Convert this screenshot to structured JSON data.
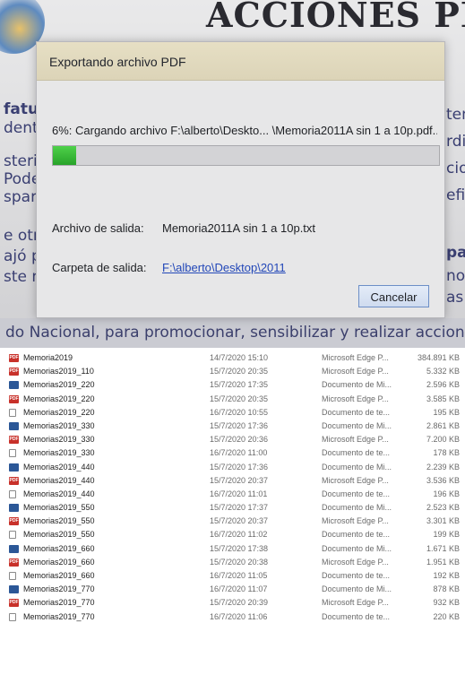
{
  "background_doc": {
    "title": "ACCIONES PRINCI",
    "left_fragments": [
      "fatur",
      "dent",
      "steric",
      "Pode",
      "spare",
      "e otr",
      "ajó p",
      "ste m"
    ],
    "right_fragments": [
      "ten",
      "rdi",
      "cion",
      "efic",
      "par",
      "nor",
      "as d"
    ],
    "bottom_line": "do Nacional, para promocionar, sensibilizar y realizar acciones ligada"
  },
  "dialog": {
    "title": "Exportando archivo PDF",
    "progress_text": "6%: Cargando archivo F:\\alberto\\Deskto... \\Memoria2011A sin 1 a 10p.pdf...",
    "progress_fraction": 0.06,
    "output_file_label": "Archivo de salida:",
    "output_file_value": "Memoria2011A sin 1 a 10p.txt",
    "output_folder_label": "Carpeta de salida:",
    "output_folder_value": "F:\\alberto\\Desktop\\2011",
    "cancel_label": "Cancelar"
  },
  "files": [
    {
      "icon": "pdf",
      "name": "Memoria2019",
      "date": "14/7/2020 15:10",
      "type": "Microsoft Edge P...",
      "size": "384.891 KB"
    },
    {
      "icon": "pdf",
      "name": "Memorias2019_110",
      "date": "15/7/2020 20:35",
      "type": "Microsoft Edge P...",
      "size": "5.332 KB"
    },
    {
      "icon": "doc",
      "name": "Memorias2019_220",
      "date": "15/7/2020 17:35",
      "type": "Documento de Mi...",
      "size": "2.596 KB"
    },
    {
      "icon": "pdf",
      "name": "Memorias2019_220",
      "date": "15/7/2020 20:35",
      "type": "Microsoft Edge P...",
      "size": "3.585 KB"
    },
    {
      "icon": "txt",
      "name": "Memorias2019_220",
      "date": "16/7/2020 10:55",
      "type": "Documento de te...",
      "size": "195 KB"
    },
    {
      "icon": "doc",
      "name": "Memorias2019_330",
      "date": "15/7/2020 17:36",
      "type": "Documento de Mi...",
      "size": "2.861 KB"
    },
    {
      "icon": "pdf",
      "name": "Memorias2019_330",
      "date": "15/7/2020 20:36",
      "type": "Microsoft Edge P...",
      "size": "7.200 KB"
    },
    {
      "icon": "txt",
      "name": "Memorias2019_330",
      "date": "16/7/2020 11:00",
      "type": "Documento de te...",
      "size": "178 KB"
    },
    {
      "icon": "doc",
      "name": "Memorias2019_440",
      "date": "15/7/2020 17:36",
      "type": "Documento de Mi...",
      "size": "2.239 KB"
    },
    {
      "icon": "pdf",
      "name": "Memorias2019_440",
      "date": "15/7/2020 20:37",
      "type": "Microsoft Edge P...",
      "size": "3.536 KB"
    },
    {
      "icon": "txt",
      "name": "Memorias2019_440",
      "date": "16/7/2020 11:01",
      "type": "Documento de te...",
      "size": "196 KB"
    },
    {
      "icon": "doc",
      "name": "Memorias2019_550",
      "date": "15/7/2020 17:37",
      "type": "Documento de Mi...",
      "size": "2.523 KB"
    },
    {
      "icon": "pdf",
      "name": "Memorias2019_550",
      "date": "15/7/2020 20:37",
      "type": "Microsoft Edge P...",
      "size": "3.301 KB"
    },
    {
      "icon": "txt",
      "name": "Memorias2019_550",
      "date": "16/7/2020 11:02",
      "type": "Documento de te...",
      "size": "199 KB"
    },
    {
      "icon": "doc",
      "name": "Memorias2019_660",
      "date": "15/7/2020 17:38",
      "type": "Documento de Mi...",
      "size": "1.671 KB"
    },
    {
      "icon": "pdf",
      "name": "Memorias2019_660",
      "date": "15/7/2020 20:38",
      "type": "Microsoft Edge P...",
      "size": "1.951 KB"
    },
    {
      "icon": "txt",
      "name": "Memorias2019_660",
      "date": "16/7/2020 11:05",
      "type": "Documento de te...",
      "size": "192 KB"
    },
    {
      "icon": "doc",
      "name": "Memorias2019_770",
      "date": "16/7/2020 11:07",
      "type": "Documento de Mi...",
      "size": "878 KB"
    },
    {
      "icon": "pdf",
      "name": "Memorias2019_770",
      "date": "15/7/2020 20:39",
      "type": "Microsoft Edge P...",
      "size": "932 KB"
    },
    {
      "icon": "txt",
      "name": "Memorias2019_770",
      "date": "16/7/2020 11:06",
      "type": "Documento de te...",
      "size": "220 KB"
    }
  ]
}
